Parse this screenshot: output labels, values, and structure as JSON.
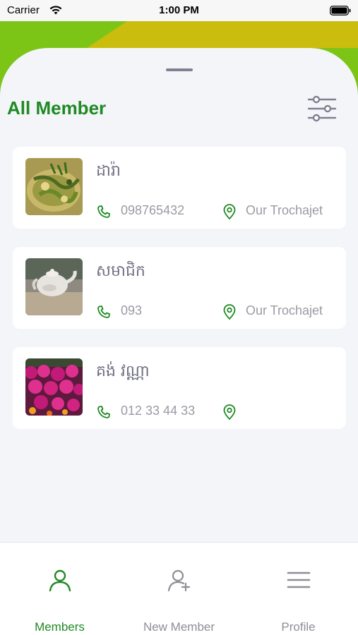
{
  "status_bar": {
    "carrier": "Carrier",
    "time": "1:00 PM",
    "icons": [
      "wifi-icon",
      "battery-icon"
    ]
  },
  "header": {
    "title": "All Member",
    "filter_icon": "sliders-icon"
  },
  "colors": {
    "accent": "#1f8a23",
    "header_green": "#7cc516",
    "header_olive": "#cbbd0d",
    "muted_text": "#9a9aa5",
    "name_text": "#6e6e82",
    "tab_inactive": "#8e8e96"
  },
  "members": [
    {
      "name": "ដារ៉ា",
      "phone": "098765432",
      "location": "Our Trochajet",
      "photo": "food-bowl-photo"
    },
    {
      "name": "សមាជិក",
      "phone": "093",
      "location": "Our Trochajet",
      "photo": "teapot-photo"
    },
    {
      "name": "គង់ វណ្ណា",
      "phone": "012 33 44 33",
      "location": "",
      "photo": "flowers-photo"
    }
  ],
  "tabs": [
    {
      "label": "Members",
      "icon": "person-icon",
      "active": true
    },
    {
      "label": "New Member",
      "icon": "person-add-icon",
      "active": false
    },
    {
      "label": "Profile",
      "icon": "menu-icon",
      "active": false
    }
  ]
}
